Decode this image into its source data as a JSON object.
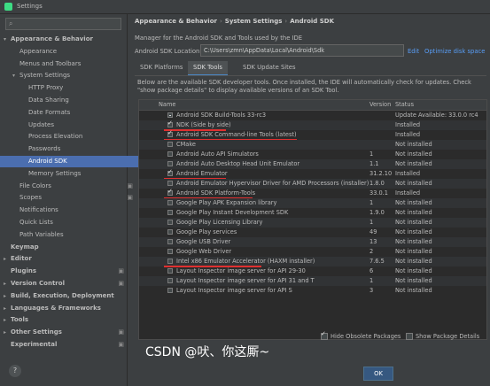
{
  "window": {
    "title": "Settings"
  },
  "sidebar": {
    "search_placeholder": "",
    "items": [
      {
        "label": "Appearance & Behavior",
        "level": 0,
        "arrow": "▾",
        "bold": true
      },
      {
        "label": "Appearance",
        "level": 1
      },
      {
        "label": "Menus and Toolbars",
        "level": 1
      },
      {
        "label": "System Settings",
        "level": 1,
        "arrow": "▾"
      },
      {
        "label": "HTTP Proxy",
        "level": 2
      },
      {
        "label": "Data Sharing",
        "level": 2
      },
      {
        "label": "Date Formats",
        "level": 2
      },
      {
        "label": "Updates",
        "level": 2
      },
      {
        "label": "Process Elevation",
        "level": 2
      },
      {
        "label": "Passwords",
        "level": 2
      },
      {
        "label": "Android SDK",
        "level": 2,
        "selected": true
      },
      {
        "label": "Memory Settings",
        "level": 2
      },
      {
        "label": "File Colors",
        "level": 1,
        "cfg": true
      },
      {
        "label": "Scopes",
        "level": 1,
        "cfg": true
      },
      {
        "label": "Notifications",
        "level": 1
      },
      {
        "label": "Quick Lists",
        "level": 1
      },
      {
        "label": "Path Variables",
        "level": 1
      },
      {
        "label": "Keymap",
        "level": 0,
        "bold": true
      },
      {
        "label": "Editor",
        "level": 0,
        "arrow": "▸",
        "bold": true
      },
      {
        "label": "Plugins",
        "level": 0,
        "bold": true,
        "cfg": true
      },
      {
        "label": "Version Control",
        "level": 0,
        "arrow": "▸",
        "bold": true,
        "cfg": true
      },
      {
        "label": "Build, Execution, Deployment",
        "level": 0,
        "arrow": "▸",
        "bold": true
      },
      {
        "label": "Languages & Frameworks",
        "level": 0,
        "arrow": "▸",
        "bold": true
      },
      {
        "label": "Tools",
        "level": 0,
        "arrow": "▸",
        "bold": true
      },
      {
        "label": "Other Settings",
        "level": 0,
        "arrow": "▸",
        "bold": true,
        "cfg": true
      },
      {
        "label": "Experimental",
        "level": 0,
        "bold": true,
        "cfg": true
      }
    ]
  },
  "breadcrumb": [
    "Appearance & Behavior",
    "System Settings",
    "Android SDK"
  ],
  "description": "Manager for the Android SDK and Tools used by the IDE",
  "location": {
    "label": "Android SDK Location:",
    "value": "C:\\Users\\zmn\\AppData\\Local\\Android\\Sdk",
    "edit": "Edit",
    "optimize": "Optimize disk space"
  },
  "tabs": [
    "SDK Platforms",
    "SDK Tools",
    "SDK Update Sites"
  ],
  "active_tab": 1,
  "info_text": "Below are the available SDK developer tools. Once installed, the IDE will automatically check for updates. Check \"show package details\" to display available versions of an SDK Tool.",
  "table": {
    "headers": [
      "Name",
      "Version",
      "Status"
    ],
    "rows": [
      {
        "name": "Android SDK Build-Tools 33-rc3",
        "version": "",
        "status": "Update Available: 33.0.0 rc4",
        "check": "partial"
      },
      {
        "name": "NDK (Side by side)",
        "version": "",
        "status": "Installed",
        "check": "checked"
      },
      {
        "name": "Android SDK Command-line Tools (latest)",
        "version": "",
        "status": "Installed",
        "check": "checked"
      },
      {
        "name": "CMake",
        "version": "",
        "status": "Not installed",
        "check": "none"
      },
      {
        "name": "Android Auto API Simulators",
        "version": "1",
        "status": "Not installed",
        "check": "none"
      },
      {
        "name": "Android Auto Desktop Head Unit Emulator",
        "version": "1.1",
        "status": "Not installed",
        "check": "none"
      },
      {
        "name": "Android Emulator",
        "version": "31.2.10",
        "status": "Installed",
        "check": "checked"
      },
      {
        "name": "Android Emulator Hypervisor Driver for AMD Processors (installer)",
        "version": "1.8.0",
        "status": "Not installed",
        "check": "none"
      },
      {
        "name": "Android SDK Platform-Tools",
        "version": "33.0.1",
        "status": "Installed",
        "check": "checked"
      },
      {
        "name": "Google Play APK Expansion library",
        "version": "1",
        "status": "Not installed",
        "check": "none"
      },
      {
        "name": "Google Play Instant Development SDK",
        "version": "1.9.0",
        "status": "Not installed",
        "check": "none"
      },
      {
        "name": "Google Play Licensing Library",
        "version": "1",
        "status": "Not installed",
        "check": "none"
      },
      {
        "name": "Google Play services",
        "version": "49",
        "status": "Not installed",
        "check": "none"
      },
      {
        "name": "Google USB Driver",
        "version": "13",
        "status": "Not installed",
        "check": "none"
      },
      {
        "name": "Google Web Driver",
        "version": "2",
        "status": "Not installed",
        "check": "none"
      },
      {
        "name": "Intel x86 Emulator Accelerator (HAXM installer)",
        "version": "7.6.5",
        "status": "Not installed",
        "check": "none"
      },
      {
        "name": "Layout Inspector image server for API 29-30",
        "version": "6",
        "status": "Not installed",
        "check": "none"
      },
      {
        "name": "Layout Inspector image server for API 31 and T",
        "version": "1",
        "status": "Not installed",
        "check": "none"
      },
      {
        "name": "Layout Inspector image server for API S",
        "version": "3",
        "status": "Not installed",
        "check": "none"
      }
    ]
  },
  "options": {
    "hide_obsolete": "Hide Obsolete Packages",
    "show_details": "Show Package Details"
  },
  "ok_label": "OK",
  "watermark": "CSDN @吠、你这厮~",
  "colors": {
    "accent": "#4b6eaf",
    "link": "#589df6",
    "underline": "#e03030"
  }
}
